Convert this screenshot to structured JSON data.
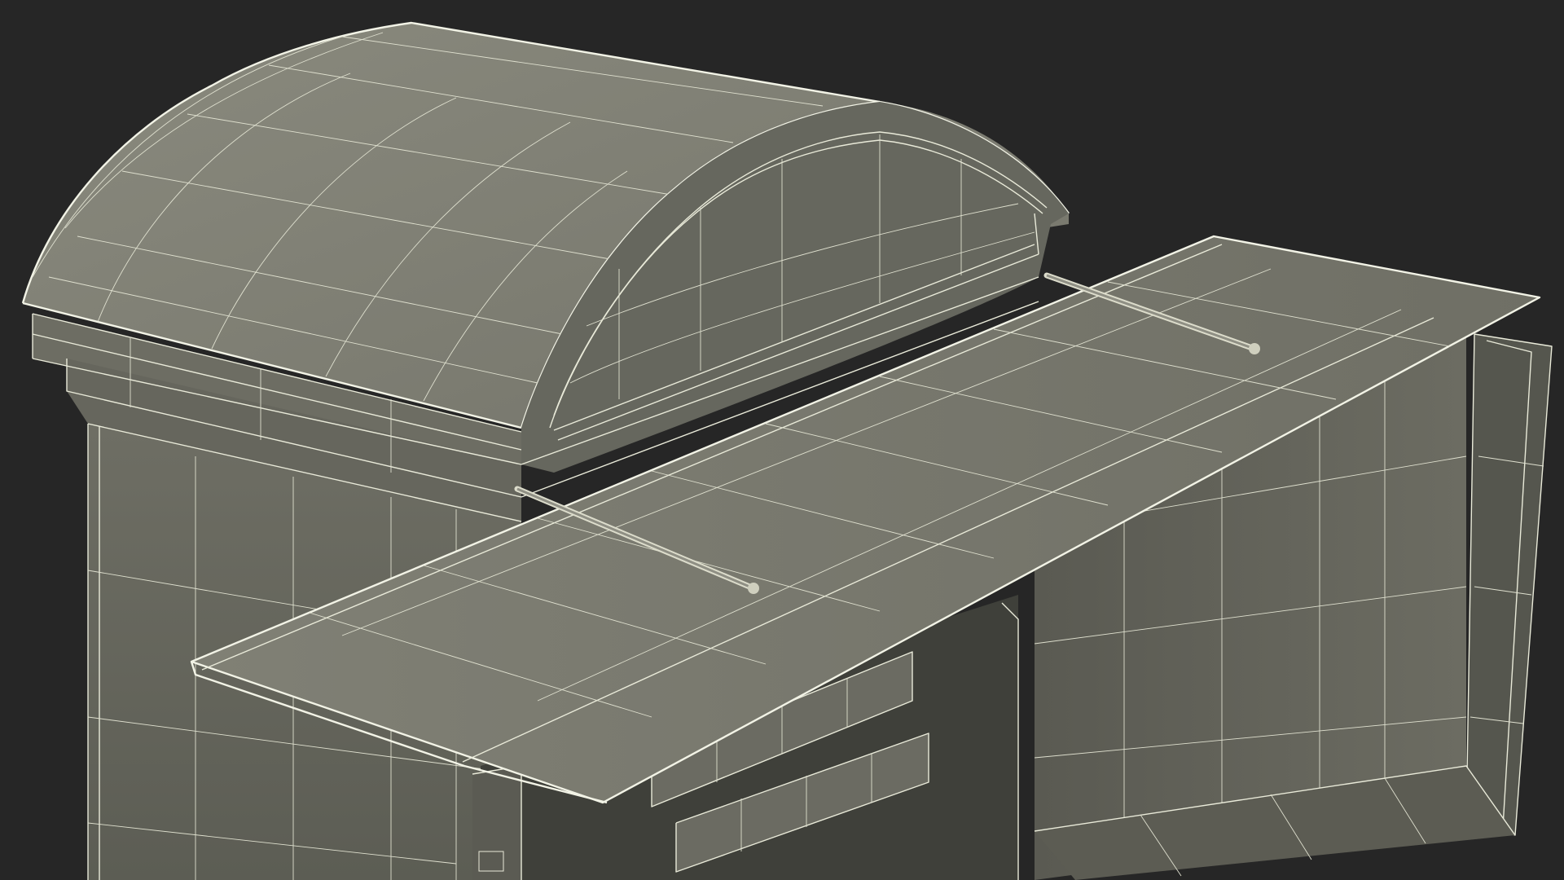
{
  "scene": {
    "background_color": "#262626",
    "surface_color": "#7b7b70",
    "surface_dark_color": "#5e5f56",
    "surface_shadow_color": "#45463f",
    "wireframe_color": "#e9ead9",
    "subject": "wireframe-kiosk-model"
  }
}
